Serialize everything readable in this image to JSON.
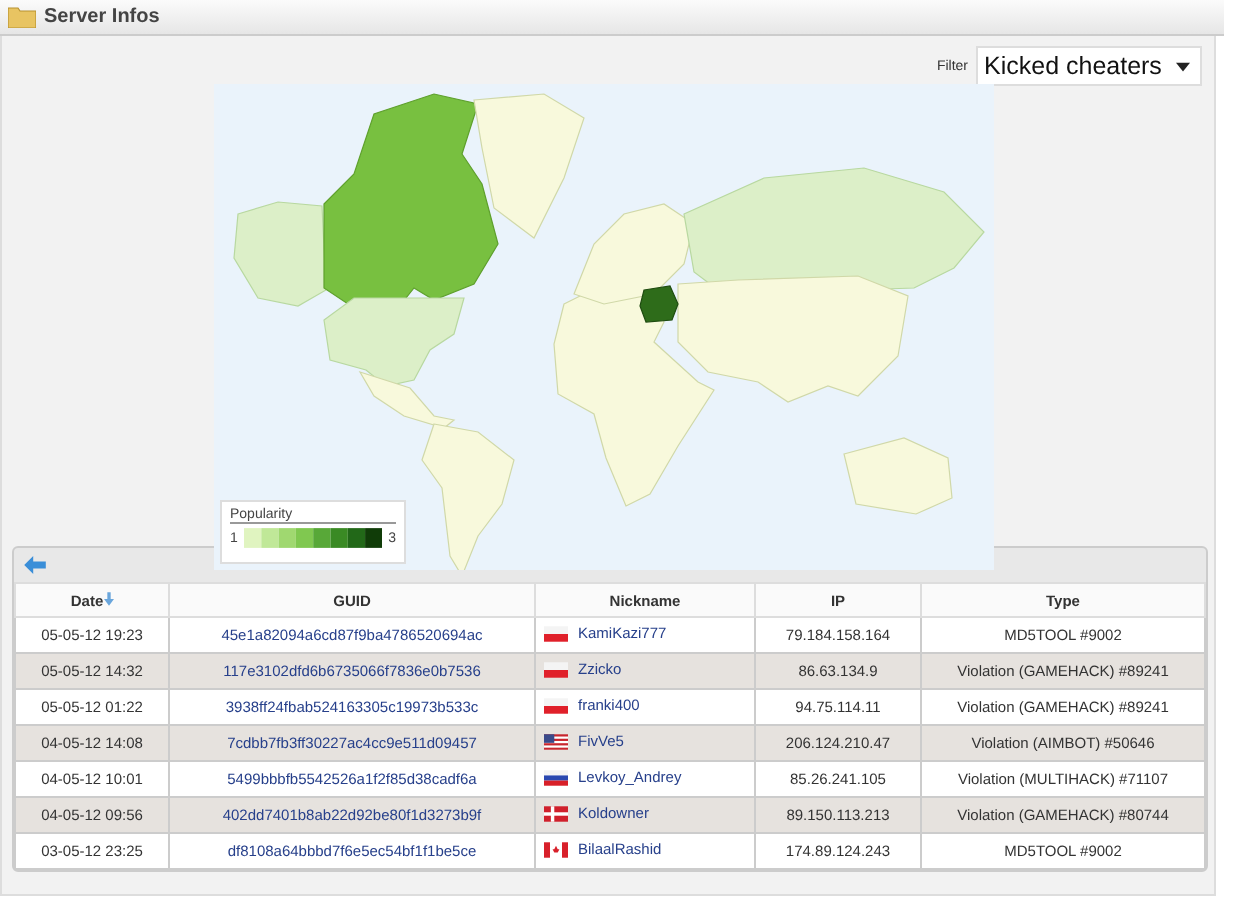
{
  "panel": {
    "title": "Server Infos"
  },
  "filter": {
    "label": "Filter",
    "value": "Kicked cheaters"
  },
  "legend": {
    "title": "Popularity",
    "min": "1",
    "max": "3"
  },
  "table": {
    "columns": [
      {
        "label": "Date",
        "sorted": true
      },
      {
        "label": "GUID",
        "sorted": false
      },
      {
        "label": "Nickname",
        "sorted": false
      },
      {
        "label": "IP",
        "sorted": false
      },
      {
        "label": "Type",
        "sorted": false
      }
    ],
    "rows": [
      {
        "date": "05-05-12 19:23",
        "guid": "45e1a82094a6cd87f9ba4786520694ac",
        "kind": "poland",
        "nickname": "KamiKazi777",
        "ip": "79.184.158.164",
        "type": "MD5TOOL #9002"
      },
      {
        "date": "05-05-12 14:32",
        "guid": "117e3102dfd6b6735066f7836e0b7536",
        "kind": "poland",
        "nickname": "Zzicko",
        "ip": "86.63.134.9",
        "type": "Violation (GAMEHACK) #89241"
      },
      {
        "date": "05-05-12 01:22",
        "guid": "3938ff24fbab524163305c19973b533c",
        "kind": "poland",
        "nickname": "franki400",
        "ip": "94.75.114.11",
        "type": "Violation (GAMEHACK) #89241"
      },
      {
        "date": "04-05-12 14:08",
        "guid": "7cdbb7fb3ff30227ac4cc9e511d09457",
        "kind": "usa",
        "nickname": "FivVe5",
        "ip": "206.124.210.47",
        "type": "Violation (AIMBOT) #50646"
      },
      {
        "date": "04-05-12 10:01",
        "guid": "5499bbbfb5542526a1f2f85d38cadf6a",
        "kind": "russia",
        "nickname": "Levkoy_Andrey",
        "ip": "85.26.241.105",
        "type": "Violation (MULTIHACK) #71107"
      },
      {
        "date": "04-05-12 09:56",
        "guid": "402dd7401b8ab22d92be80f1d3273b9f",
        "kind": "denmark",
        "nickname": "Koldowner",
        "ip": "89.150.113.213",
        "type": "Violation (GAMEHACK) #80744"
      },
      {
        "date": "03-05-12 23:25",
        "guid": "df8108a64bbbd7f6e5ec54bf1f1be5ce",
        "kind": "canada",
        "nickname": "BilaalRashid",
        "ip": "174.89.124.243",
        "type": "MD5TOOL #9002"
      }
    ]
  }
}
